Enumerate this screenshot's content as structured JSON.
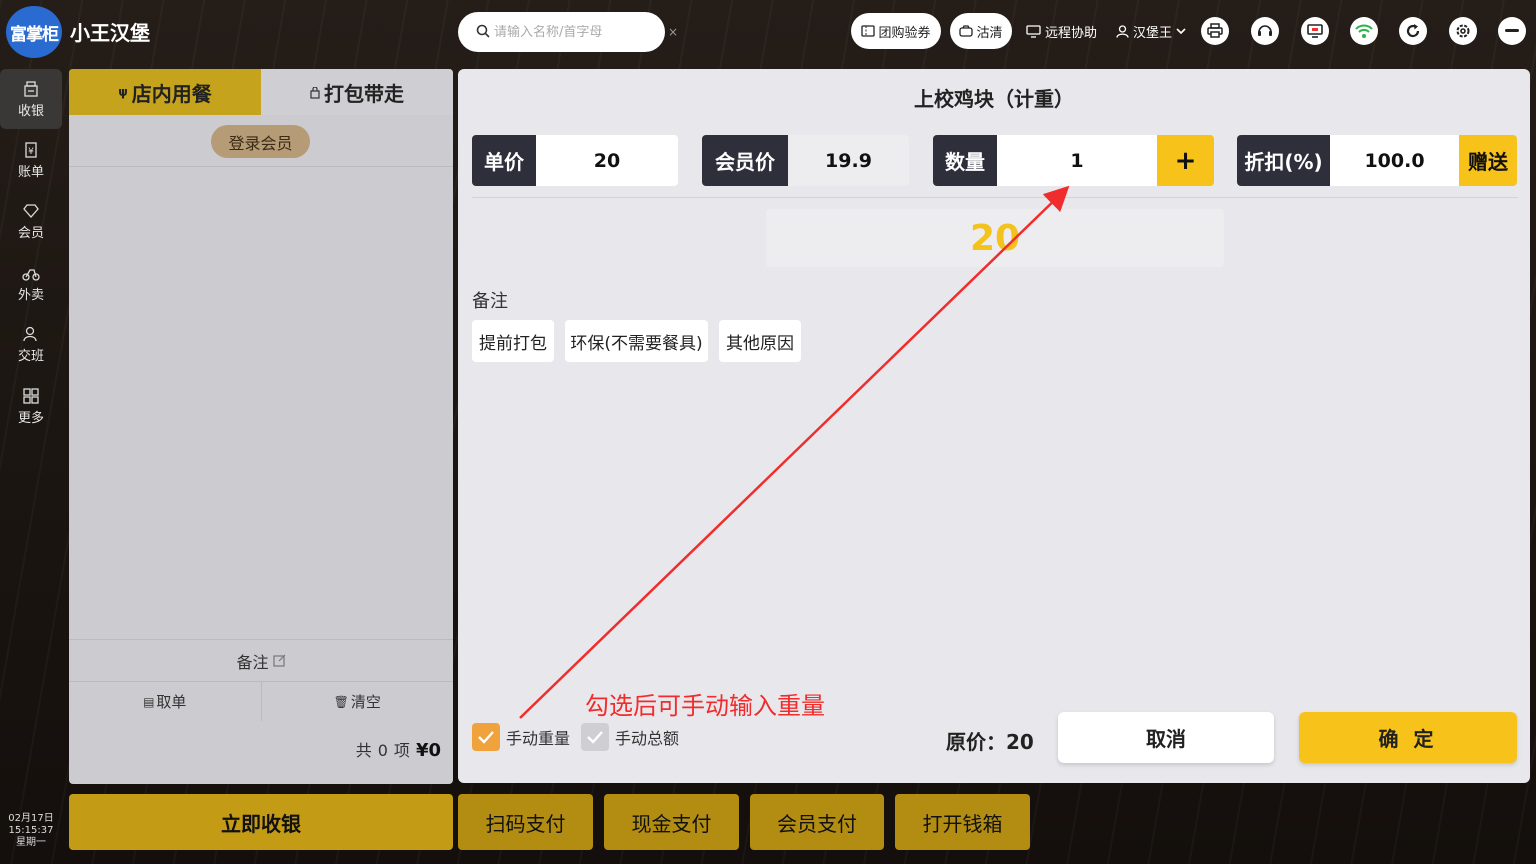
{
  "app": {
    "logo_text": "富掌柜",
    "title": "小王汉堡"
  },
  "search": {
    "placeholder": "请输入名称/首字母",
    "clear": "×"
  },
  "header": {
    "group_coupon": "团购验券",
    "clean": "沽清",
    "remote_assist": "远程协助",
    "user": "汉堡王"
  },
  "sidebar": {
    "items": [
      {
        "label": "收银",
        "icon": "cashier-icon"
      },
      {
        "label": "账单",
        "icon": "bill-icon"
      },
      {
        "label": "会员",
        "icon": "member-icon"
      },
      {
        "label": "外卖",
        "icon": "delivery-icon"
      },
      {
        "label": "交班",
        "icon": "handover-icon"
      },
      {
        "label": "更多",
        "icon": "more-icon"
      }
    ],
    "clock": {
      "date": "02月17日",
      "time": "15:15:37",
      "weekday": "星期一"
    }
  },
  "order_panel": {
    "tab_dine_in": "店内用餐",
    "tab_takeaway": "打包带走",
    "login_member": "登录会员",
    "note": "备注",
    "hold_order": "取单",
    "clear": "清空",
    "count_prefix": "共",
    "count": "0",
    "count_suffix": "项",
    "total": "¥0"
  },
  "bottom": {
    "checkout": "立即收银",
    "scan_pay": "扫码支付",
    "cash_pay": "现金支付",
    "member_pay": "会员支付",
    "open_drawer": "打开钱箱"
  },
  "dialog": {
    "title": "上校鸡块（计重）",
    "unit_price_label": "单价",
    "unit_price": "20",
    "member_price_label": "会员价",
    "member_price": "19.9",
    "quantity_label": "数量",
    "quantity": "1",
    "plus": "+",
    "discount_label": "折扣(%)",
    "discount": "100.0",
    "gift": "赠送",
    "total": "20",
    "remark_title": "备注",
    "remarks": [
      "提前打包",
      "环保(不需要餐具)",
      "其他原因"
    ],
    "annotation": "勾选后可手动输入重量",
    "manual_weight": "手动重量",
    "manual_total": "手动总额",
    "original_price": "原价：20",
    "cancel": "取消",
    "confirm": "确 定"
  },
  "colors": {
    "accent": "#f7c21a",
    "dark_label": "#2e2f3b",
    "annotation": "#f02c2c",
    "checkbox_on": "#f0a23c"
  }
}
